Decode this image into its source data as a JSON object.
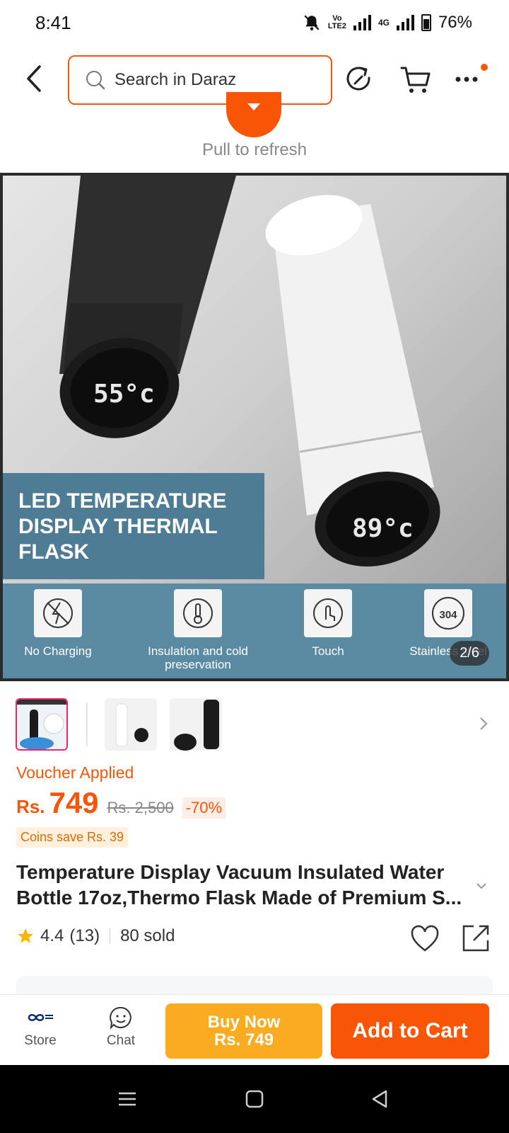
{
  "status": {
    "time": "8:41",
    "volte_line1": "Vo",
    "volte_line2": "LTE2",
    "network": "4G",
    "battery": "76%"
  },
  "header": {
    "search_placeholder": "Search in Daraz",
    "has_notification_dot": true
  },
  "refresh": {
    "text": "Pull to refresh"
  },
  "gallery": {
    "banner_title": "LED TEMPERATURE DISPLAY THERMAL FLASK",
    "display_left": "55°c",
    "display_right": "89°c",
    "features": [
      {
        "label": "No Charging"
      },
      {
        "label": "Insulation and cold preservation"
      },
      {
        "label": "Touch"
      },
      {
        "label": "Stainless steel",
        "badge": "304"
      }
    ],
    "counter": "2/6"
  },
  "product": {
    "voucher": "Voucher Applied",
    "currency": "Rs.",
    "price": "749",
    "original_price": "Rs. 2,500",
    "discount": "-70%",
    "coins": "Coins save Rs. 39",
    "title": "Temperature Display Vacuum Insulated Water Bottle 17oz,Thermo Flask Made of Premium S...",
    "rating": "4.4",
    "reviews": "(13)",
    "sold": "80 sold"
  },
  "actions": {
    "store": "Store",
    "chat": "Chat",
    "buy_now": "Buy Now",
    "buy_now_price": "Rs. 749",
    "add_to_cart": "Add to Cart"
  },
  "colors": {
    "accent": "#f85606",
    "buy_now": "#fbab1f",
    "thumb_active": "#f0246b"
  }
}
